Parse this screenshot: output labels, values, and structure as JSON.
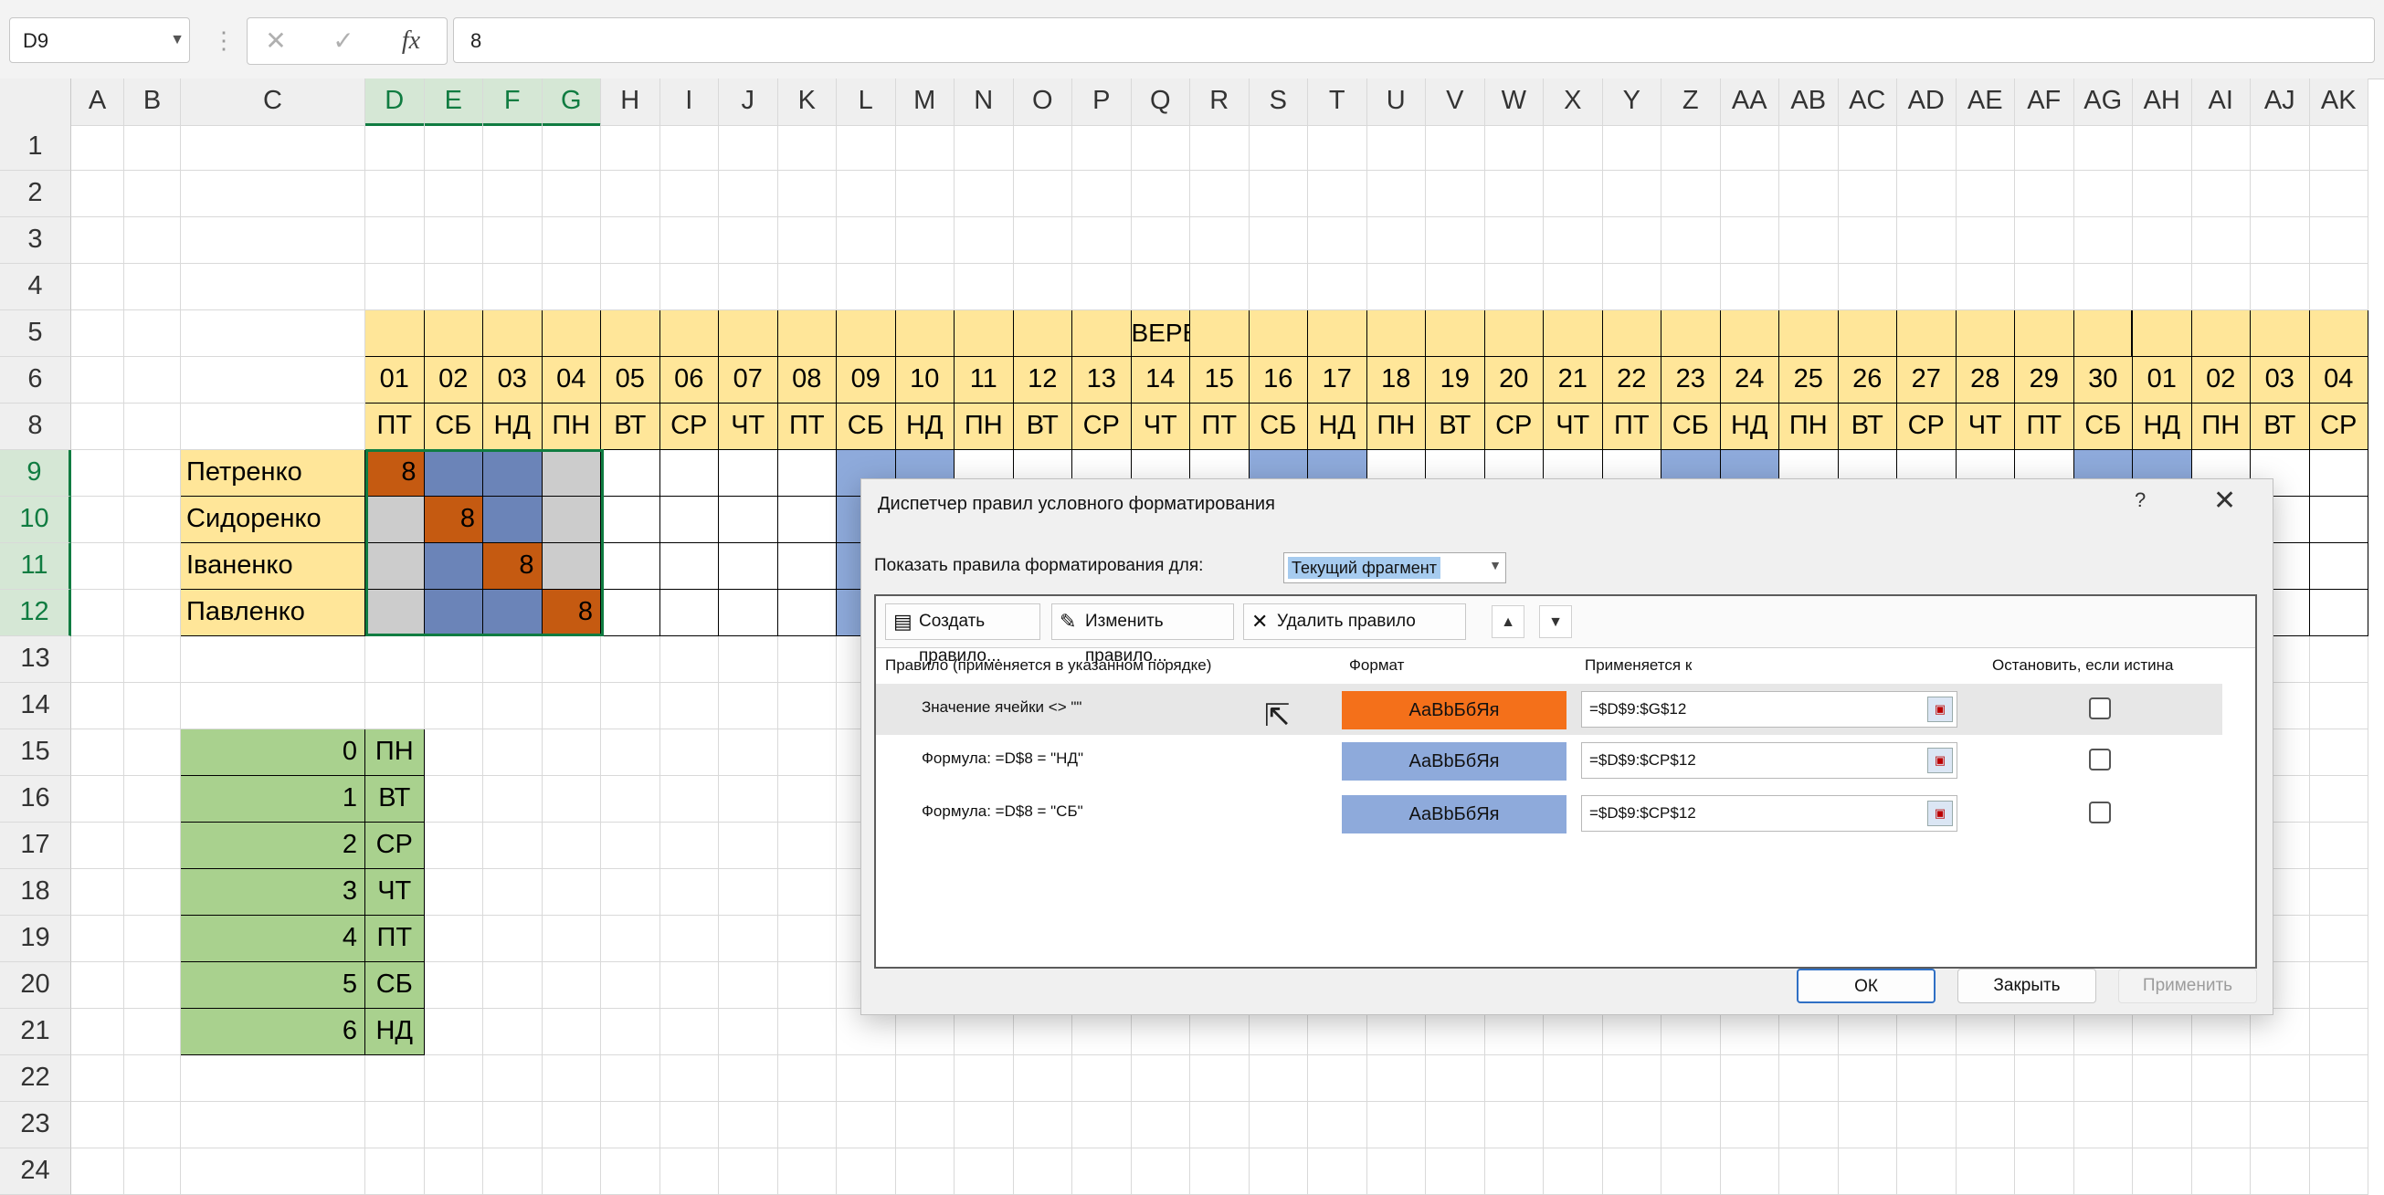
{
  "namebox": "D9",
  "formula_value": "8",
  "formula_icons": {
    "cancel": "✕",
    "enter": "✓",
    "fx": "fx"
  },
  "columns": [
    "A",
    "B",
    "C",
    "D",
    "E",
    "F",
    "G",
    "H",
    "I",
    "J",
    "K",
    "L",
    "M",
    "N",
    "O",
    "P",
    "Q",
    "R",
    "S",
    "T",
    "U",
    "V",
    "W",
    "X",
    "Y",
    "Z",
    "AA",
    "AB",
    "AC",
    "AD",
    "AE",
    "AF",
    "AG",
    "AH",
    "AI",
    "AJ",
    "AK"
  ],
  "rows": [
    "1",
    "2",
    "3",
    "4",
    "5",
    "6",
    "8",
    "9",
    "10",
    "11",
    "12",
    "13",
    "14",
    "15",
    "16",
    "17",
    "18",
    "19",
    "20",
    "21",
    "22",
    "23",
    "24"
  ],
  "month": "ВЕРЕСЕНЬ",
  "dates": [
    "01",
    "02",
    "03",
    "04",
    "05",
    "06",
    "07",
    "08",
    "09",
    "10",
    "11",
    "12",
    "13",
    "14",
    "15",
    "16",
    "17",
    "18",
    "19",
    "20",
    "21",
    "22",
    "23",
    "24",
    "25",
    "26",
    "27",
    "28",
    "29",
    "30",
    "01",
    "02",
    "03",
    "04"
  ],
  "weekdays": [
    "ПТ",
    "СБ",
    "НД",
    "ПН",
    "ВТ",
    "СР",
    "ЧТ",
    "ПТ",
    "СБ",
    "НД",
    "ПН",
    "ВТ",
    "СР",
    "ЧТ",
    "ПТ",
    "СБ",
    "НД",
    "ПН",
    "ВТ",
    "СР",
    "ЧТ",
    "ПТ",
    "СБ",
    "НД",
    "ПН",
    "ВТ",
    "СР",
    "ЧТ",
    "ПТ",
    "СБ",
    "НД",
    "ПН",
    "ВТ",
    "СР"
  ],
  "employees": [
    {
      "name": "Петренко",
      "value": "8"
    },
    {
      "name": "Сидоренко",
      "value": "8"
    },
    {
      "name": "Іваненко",
      "value": "8"
    },
    {
      "name": "Павленко",
      "value": "8"
    }
  ],
  "lookup": [
    {
      "num": "0",
      "day": "ПН"
    },
    {
      "num": "1",
      "day": "ВТ"
    },
    {
      "num": "2",
      "day": "СР"
    },
    {
      "num": "3",
      "day": "ЧТ"
    },
    {
      "num": "4",
      "day": "ПТ"
    },
    {
      "num": "5",
      "day": "СБ"
    },
    {
      "num": "6",
      "day": "НД"
    }
  ],
  "colors": {
    "orange": "#c55a11",
    "rule_orange": "#f4701a",
    "blue": "#8eaadb",
    "navy": "#6b84b8",
    "yellow": "#ffe699",
    "green": "#a9d18e"
  },
  "dialog": {
    "title": "Диспетчер правил условного форматирования",
    "help": "?",
    "close": "✕",
    "show_label": "Показать правила форматирования для:",
    "show_value": "Текущий фрагмент",
    "new_rule": "Создать правило...",
    "edit_rule": "Изменить правило...",
    "delete_rule": "Удалить правило",
    "headers": {
      "rule": "Правило (применяется в указанном порядке)",
      "format": "Формат",
      "applies": "Применяется к",
      "stop": "Остановить, если истина"
    },
    "rules": [
      {
        "text": "Значение ячейки <> \"\"",
        "format": "АаBbБбЯя",
        "applies": "=$D$9:$G$12"
      },
      {
        "text": "Формула: =D$8 = \"НД\"",
        "format": "АаBbБбЯя",
        "applies": "=$D$9:$CP$12"
      },
      {
        "text": "Формула: =D$8 = \"СБ\"",
        "format": "АаBbБбЯя",
        "applies": "=$D$9:$CP$12"
      }
    ],
    "ok": "ОК",
    "close_button": "Закрыть",
    "apply": "Применить"
  }
}
